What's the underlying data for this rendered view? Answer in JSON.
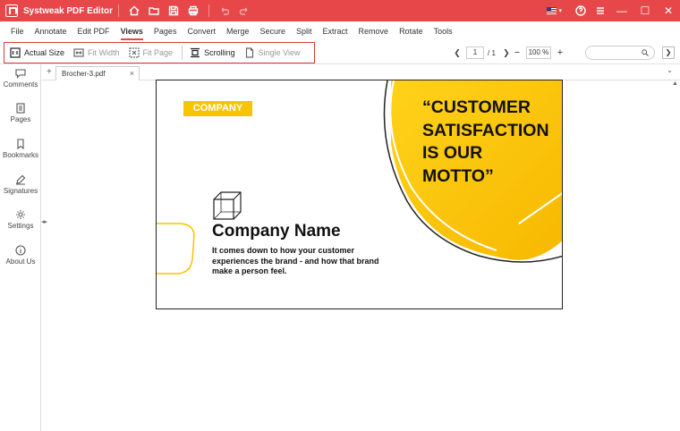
{
  "app": {
    "title": "Systweak PDF Editor"
  },
  "menu": [
    "File",
    "Annotate",
    "Edit PDF",
    "Views",
    "Pages",
    "Convert",
    "Merge",
    "Secure",
    "Split",
    "Extract",
    "Remove",
    "Rotate",
    "Tools"
  ],
  "menu_active": "Views",
  "toolbar": {
    "actual_size": "Actual Size",
    "fit_width": "Fit Width",
    "fit_page": "Fit Page",
    "scrolling": "Scrolling",
    "single_view": "Single View",
    "current_page": "1",
    "total_pages": "/ 1",
    "zoom": "100 %"
  },
  "sidebar": {
    "comments": "Comments",
    "pages": "Pages",
    "bookmarks": "Bookmarks",
    "signatures": "Signatures",
    "settings": "Settings",
    "about": "About Us"
  },
  "tab": {
    "name": "Brocher-3.pdf"
  },
  "document": {
    "company_label": "COMPANY",
    "quote_lines": [
      "“CUSTOMER",
      "SATISFACTION",
      "IS OUR",
      "MOTTO”"
    ],
    "company_name": "Company Name",
    "desc_lines": [
      "It comes down to how your customer",
      "experiences the brand - and how that brand",
      "make a person feel."
    ]
  },
  "colors": {
    "titlebar": "#e8474a",
    "accent_yellow": "#f7c400",
    "highlight_border": "#d93a3a"
  }
}
